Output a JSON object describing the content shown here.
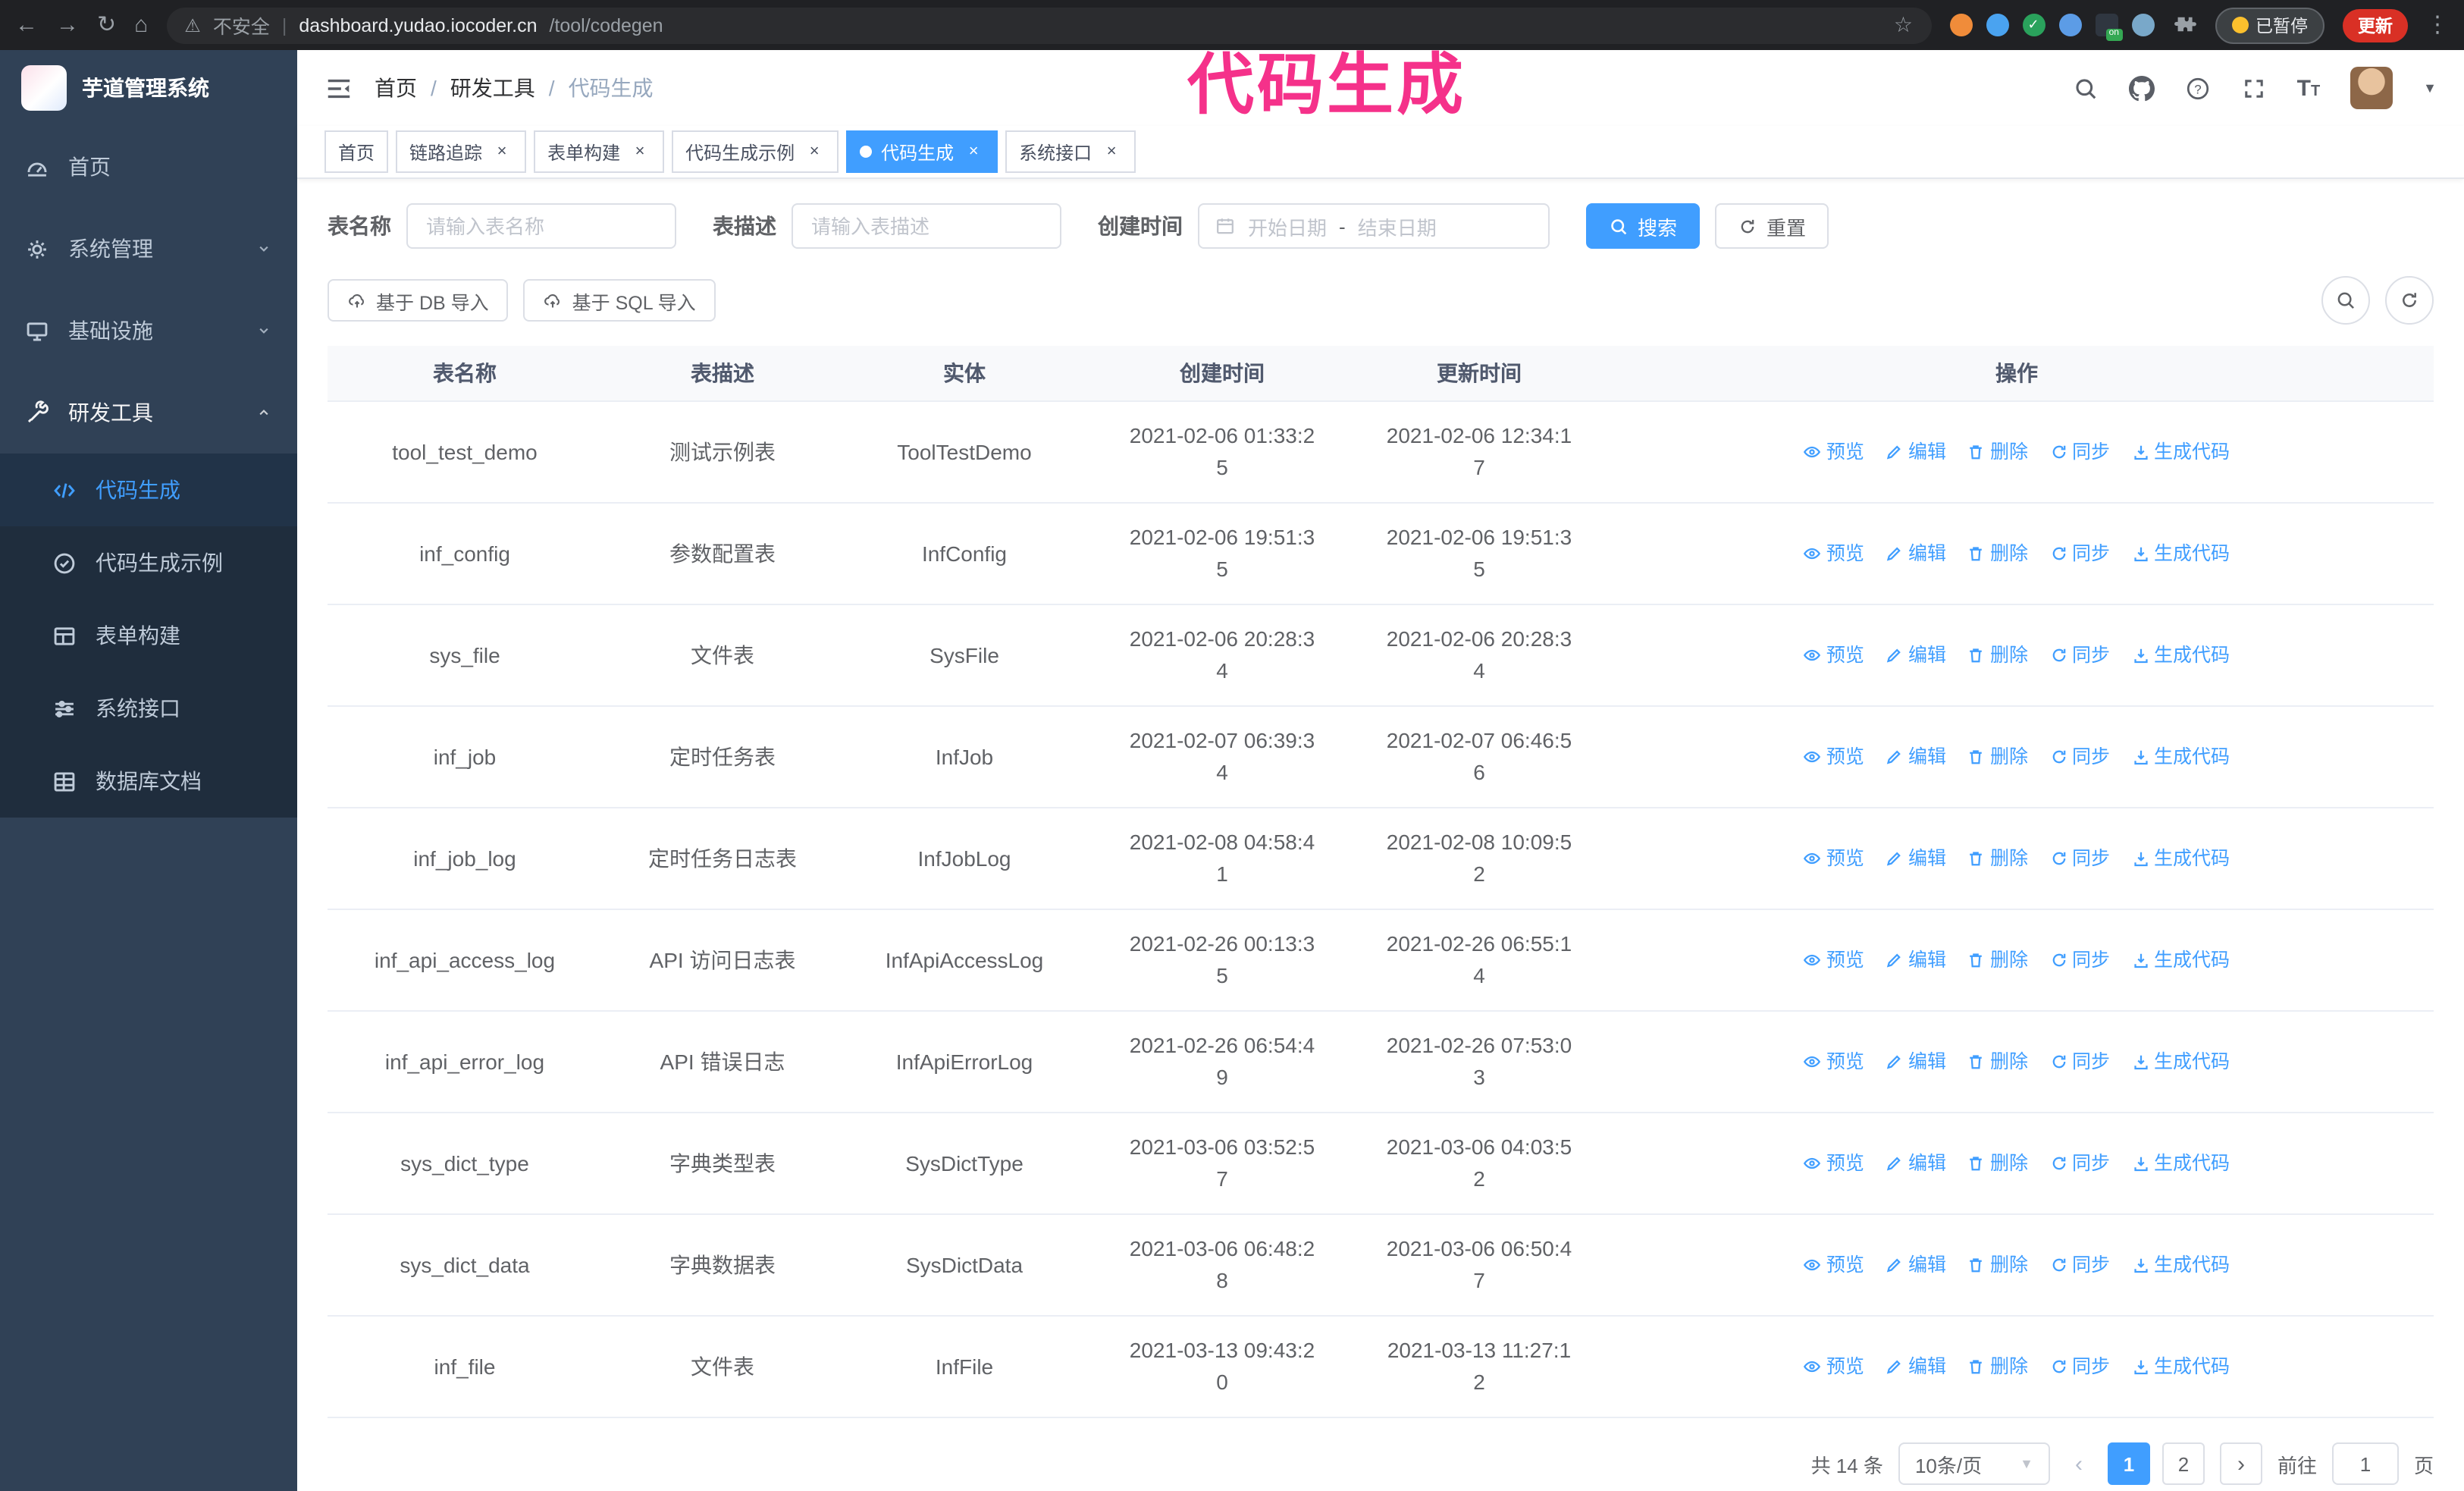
{
  "annotation": {
    "text": "代码生成"
  },
  "colors": {
    "accent": "#409eff",
    "sidebar_bg": "#304156",
    "submenu_bg": "#1f2d3d",
    "annotation_pink": "#f5318a",
    "update_button_bg": "#d93025",
    "link_blue": "#409eff"
  },
  "browser": {
    "security_warning": "不安全",
    "url_host": "dashboard.yudao.iocoder.cn",
    "url_path": "/tool/codegen",
    "extensions": [
      {
        "name": "fox-extension-icon",
        "color": "#f08c3a"
      },
      {
        "name": "droplet-extension-icon",
        "color": "#4aa3f0"
      },
      {
        "name": "check-extension-icon",
        "color": "#2aa25c",
        "glyph": "✓"
      },
      {
        "name": "users-extension-icon",
        "color": "#5c9ce6"
      },
      {
        "name": "proxy-on-extension-icon",
        "color": "#2f3640",
        "badge": "on"
      },
      {
        "name": "feather-extension-icon",
        "color": "#79a8c9"
      }
    ],
    "paused_badge": "已暂停",
    "update_button": "更新"
  },
  "sidebar": {
    "logo_title": "芋道管理系统",
    "items": [
      {
        "id": "home",
        "label": "首页",
        "icon": "dashboard-icon"
      },
      {
        "id": "system",
        "label": "系统管理",
        "icon": "gear-icon",
        "chevron": "down"
      },
      {
        "id": "infra",
        "label": "基础设施",
        "icon": "monitor-icon",
        "chevron": "down"
      },
      {
        "id": "devtools",
        "label": "研发工具",
        "icon": "tools-icon",
        "chevron": "up",
        "open": true
      }
    ],
    "submenu": [
      {
        "id": "codegen",
        "label": "代码生成",
        "icon": "code-icon",
        "active": true
      },
      {
        "id": "codegen-demo",
        "label": "代码生成示例",
        "icon": "check-badge-icon"
      },
      {
        "id": "form-build",
        "label": "表单构建",
        "icon": "form-icon"
      },
      {
        "id": "system-api",
        "label": "系统接口",
        "icon": "sliders-icon"
      },
      {
        "id": "db-doc",
        "label": "数据库文档",
        "icon": "grid-icon"
      }
    ]
  },
  "header": {
    "breadcrumb": [
      "首页",
      "研发工具",
      "代码生成"
    ]
  },
  "tabs": [
    {
      "label": "首页",
      "closable": false,
      "active": false
    },
    {
      "label": "链路追踪",
      "closable": true,
      "active": false
    },
    {
      "label": "表单构建",
      "closable": true,
      "active": false
    },
    {
      "label": "代码生成示例",
      "closable": true,
      "active": false
    },
    {
      "label": "代码生成",
      "closable": true,
      "active": true
    },
    {
      "label": "系统接口",
      "closable": true,
      "active": false
    }
  ],
  "filters": {
    "table_name_label": "表名称",
    "table_name_placeholder": "请输入表名称",
    "table_desc_label": "表描述",
    "table_desc_placeholder": "请输入表描述",
    "create_time_label": "创建时间",
    "start_date_placeholder": "开始日期",
    "range_separator": "-",
    "end_date_placeholder": "结束日期",
    "search_button": "搜索",
    "reset_button": "重置"
  },
  "toolbar": {
    "import_db": "基于 DB 导入",
    "import_sql": "基于 SQL 导入"
  },
  "table": {
    "columns": [
      "表名称",
      "表描述",
      "实体",
      "创建时间",
      "更新时间",
      "操作"
    ],
    "actions": [
      "预览",
      "编辑",
      "删除",
      "同步",
      "生成代码"
    ],
    "rows": [
      {
        "name": "tool_test_demo",
        "desc": "测试示例表",
        "entity": "ToolTestDemo",
        "created": "2021-02-06 01:33:25",
        "updated": "2021-02-06 12:34:17"
      },
      {
        "name": "inf_config",
        "desc": "参数配置表",
        "entity": "InfConfig",
        "created": "2021-02-06 19:51:35",
        "updated": "2021-02-06 19:51:35"
      },
      {
        "name": "sys_file",
        "desc": "文件表",
        "entity": "SysFile",
        "created": "2021-02-06 20:28:34",
        "updated": "2021-02-06 20:28:34"
      },
      {
        "name": "inf_job",
        "desc": "定时任务表",
        "entity": "InfJob",
        "created": "2021-02-07 06:39:34",
        "updated": "2021-02-07 06:46:56"
      },
      {
        "name": "inf_job_log",
        "desc": "定时任务日志表",
        "entity": "InfJobLog",
        "created": "2021-02-08 04:58:41",
        "updated": "2021-02-08 10:09:52"
      },
      {
        "name": "inf_api_access_log",
        "desc": "API 访问日志表",
        "entity": "InfApiAccessLog",
        "created": "2021-02-26 00:13:35",
        "updated": "2021-02-26 06:55:14"
      },
      {
        "name": "inf_api_error_log",
        "desc": "API 错误日志",
        "entity": "InfApiErrorLog",
        "created": "2021-02-26 06:54:49",
        "updated": "2021-02-26 07:53:03"
      },
      {
        "name": "sys_dict_type",
        "desc": "字典类型表",
        "entity": "SysDictType",
        "created": "2021-03-06 03:52:57",
        "updated": "2021-03-06 04:03:52"
      },
      {
        "name": "sys_dict_data",
        "desc": "字典数据表",
        "entity": "SysDictData",
        "created": "2021-03-06 06:48:28",
        "updated": "2021-03-06 06:50:47"
      },
      {
        "name": "inf_file",
        "desc": "文件表",
        "entity": "InfFile",
        "created": "2021-03-13 09:43:20",
        "updated": "2021-03-13 11:27:12"
      }
    ]
  },
  "pagination": {
    "total_text": "共 14 条",
    "page_size": "10条/页",
    "pages": [
      "1",
      "2"
    ],
    "active_page": "1",
    "goto_label": "前往",
    "goto_value": "1",
    "goto_suffix": "页"
  }
}
